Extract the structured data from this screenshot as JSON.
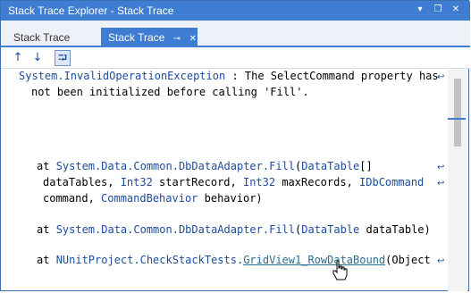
{
  "window": {
    "title": "Stack Trace Explorer - Stack Trace"
  },
  "title_buttons": {
    "dropdown": "▾",
    "restore": "❐",
    "close": "✕"
  },
  "tabs": [
    {
      "label": "Stack Trace",
      "active": false
    },
    {
      "label": "Stack Trace",
      "active": true,
      "pin": "⊸",
      "close": "✕"
    }
  ],
  "toolbar": {
    "up": "↑",
    "down": "↓",
    "wrap_toggle": "⮒"
  },
  "trace": {
    "exception_type": "System.InvalidOperationException",
    "exception_sep": " : ",
    "exception_msg_1": "The SelectCommand property has",
    "exception_msg_2": "not been initialized before calling 'Fill'.",
    "frame1_at": "at ",
    "frame1_ns": "System.Data.Common.DbDataAdapter.",
    "frame1_method": "Fill",
    "frame1_args_a": "(",
    "frame1_type1": "DataTable",
    "frame1_args_b": "[]",
    "frame1_l2_a": "dataTables, ",
    "frame1_l2_int1": "Int32",
    "frame1_l2_b": " startRecord, ",
    "frame1_l2_int2": "Int32",
    "frame1_l2_c": " maxRecords, ",
    "frame1_l2_idb": "IDbCommand",
    "frame1_l3_a": "command, ",
    "frame1_l3_cb": "CommandBehavior",
    "frame1_l3_b": " behavior)",
    "frame2_at": "at ",
    "frame2_ns": "System.Data.Common.DbDataAdapter.",
    "frame2_method": "Fill",
    "frame2_a": "(",
    "frame2_type": "DataTable",
    "frame2_b": " dataTable)",
    "frame3_at": "at ",
    "frame3_ns": "NUnitProject.CheckStackTests.",
    "frame3_method": "GridView1_RowDataBound",
    "frame3_a": "(Object"
  },
  "wrap_glyph": "↩",
  "colors": {
    "titlebar": "#3e7dd1",
    "namespace": "#1d4c9a",
    "link": "#2a6e93"
  }
}
